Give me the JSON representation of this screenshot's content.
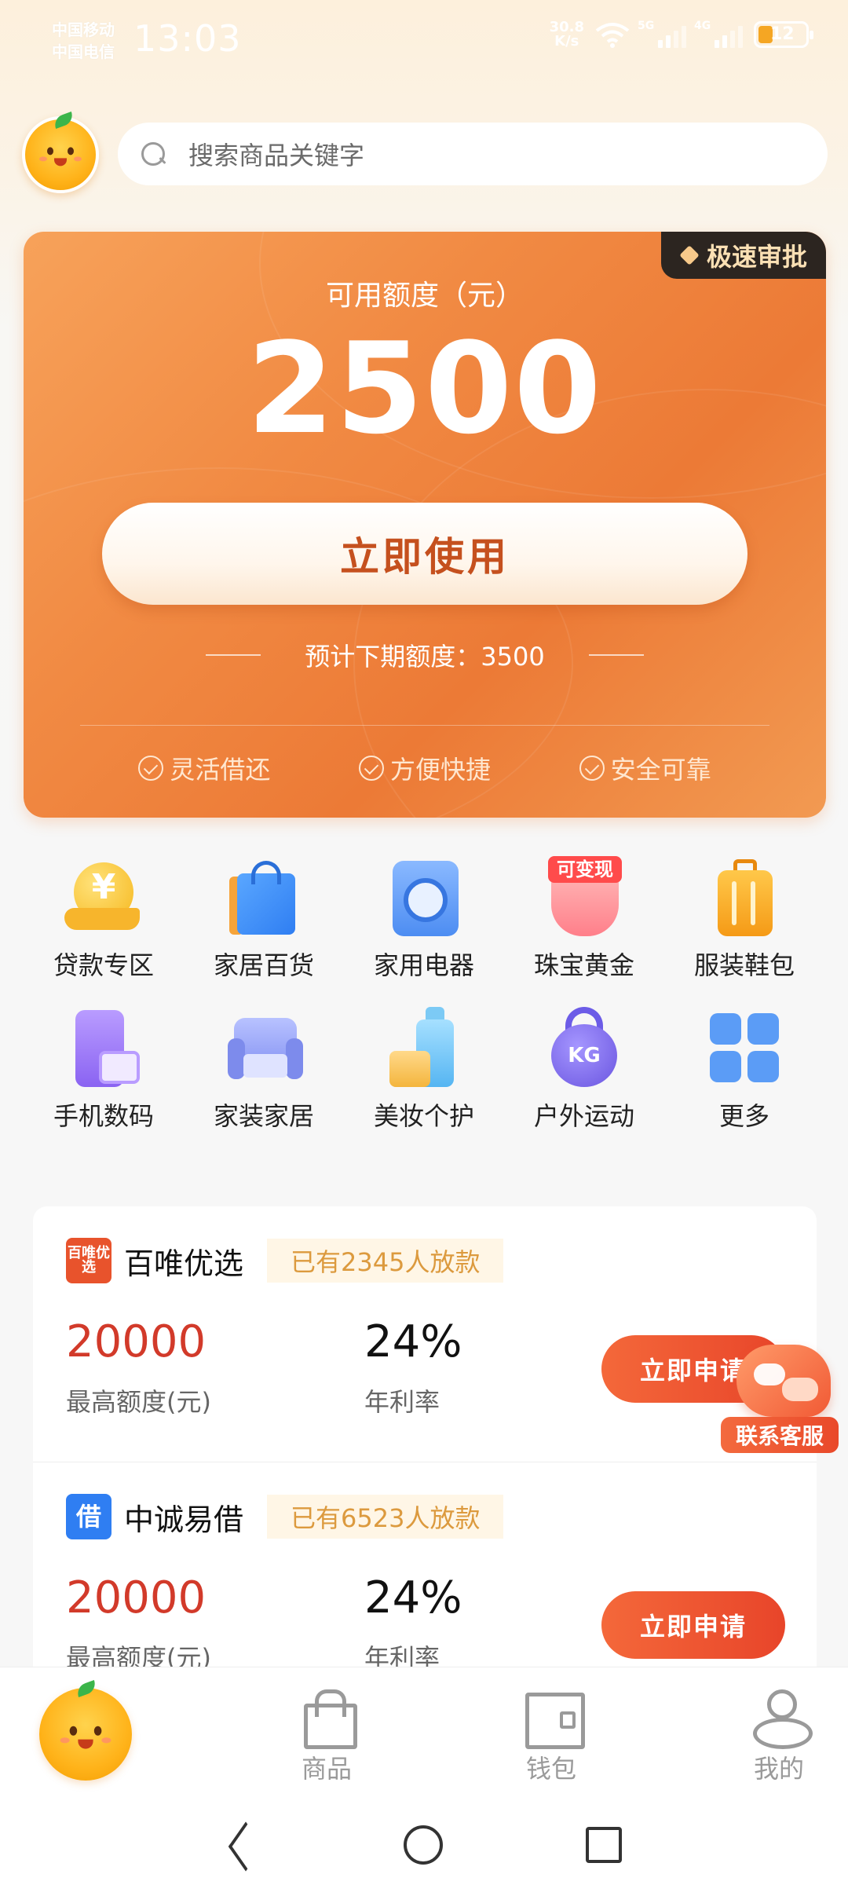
{
  "status_bar": {
    "carrier1": "中国移动",
    "carrier2": "中国电信",
    "time": "13:03",
    "net_speed_value": "30.8",
    "net_speed_unit": "K/s",
    "signal1_tag": "5G",
    "signal2_tag": "4G",
    "battery": "12"
  },
  "search": {
    "placeholder": "搜索商品关键字"
  },
  "credit_card": {
    "badge": "极速审批",
    "label": "可用额度（元）",
    "amount": "2500",
    "button": "立即使用",
    "next_quota": "预计下期额度：3500",
    "features": [
      "灵活借还",
      "方便快捷",
      "安全可靠"
    ]
  },
  "categories": [
    {
      "label": "贷款专区",
      "icon": "loan-coin-icon"
    },
    {
      "label": "家居百货",
      "icon": "shopping-bag-icon"
    },
    {
      "label": "家用电器",
      "icon": "washing-machine-icon"
    },
    {
      "label": "珠宝黄金",
      "icon": "jewelry-icon",
      "tag": "可变现"
    },
    {
      "label": "服装鞋包",
      "icon": "luggage-icon"
    },
    {
      "label": "手机数码",
      "icon": "phone-icon"
    },
    {
      "label": "家装家居",
      "icon": "sofa-icon"
    },
    {
      "label": "美妆个护",
      "icon": "cosmetics-icon"
    },
    {
      "label": "户外运动",
      "icon": "kettlebell-icon",
      "tag": "KG"
    },
    {
      "label": "更多",
      "icon": "more-grid-icon"
    }
  ],
  "products": [
    {
      "name": "百唯优选",
      "logo_text": "百唯优选",
      "tag": "已有2345人放款",
      "amount": "20000",
      "amount_label": "最高额度(元)",
      "rate": "24%",
      "rate_label": "年利率",
      "button": "立即申请"
    },
    {
      "name": "中诚易借",
      "logo_text": "借",
      "tag": "已有6523人放款",
      "amount": "20000",
      "amount_label": "最高额度(元)",
      "rate": "24%",
      "rate_label": "年利率",
      "button": "立即申请"
    }
  ],
  "customer_service": {
    "label": "联系客服"
  },
  "tab_bar": {
    "goods": "商品",
    "wallet": "钱包",
    "me": "我的"
  },
  "colors": {
    "accent": "#ec7a36",
    "amount_red": "#d23a2a",
    "tag_gold": "#dc9a3e",
    "badge_dark": "#2c2520"
  }
}
